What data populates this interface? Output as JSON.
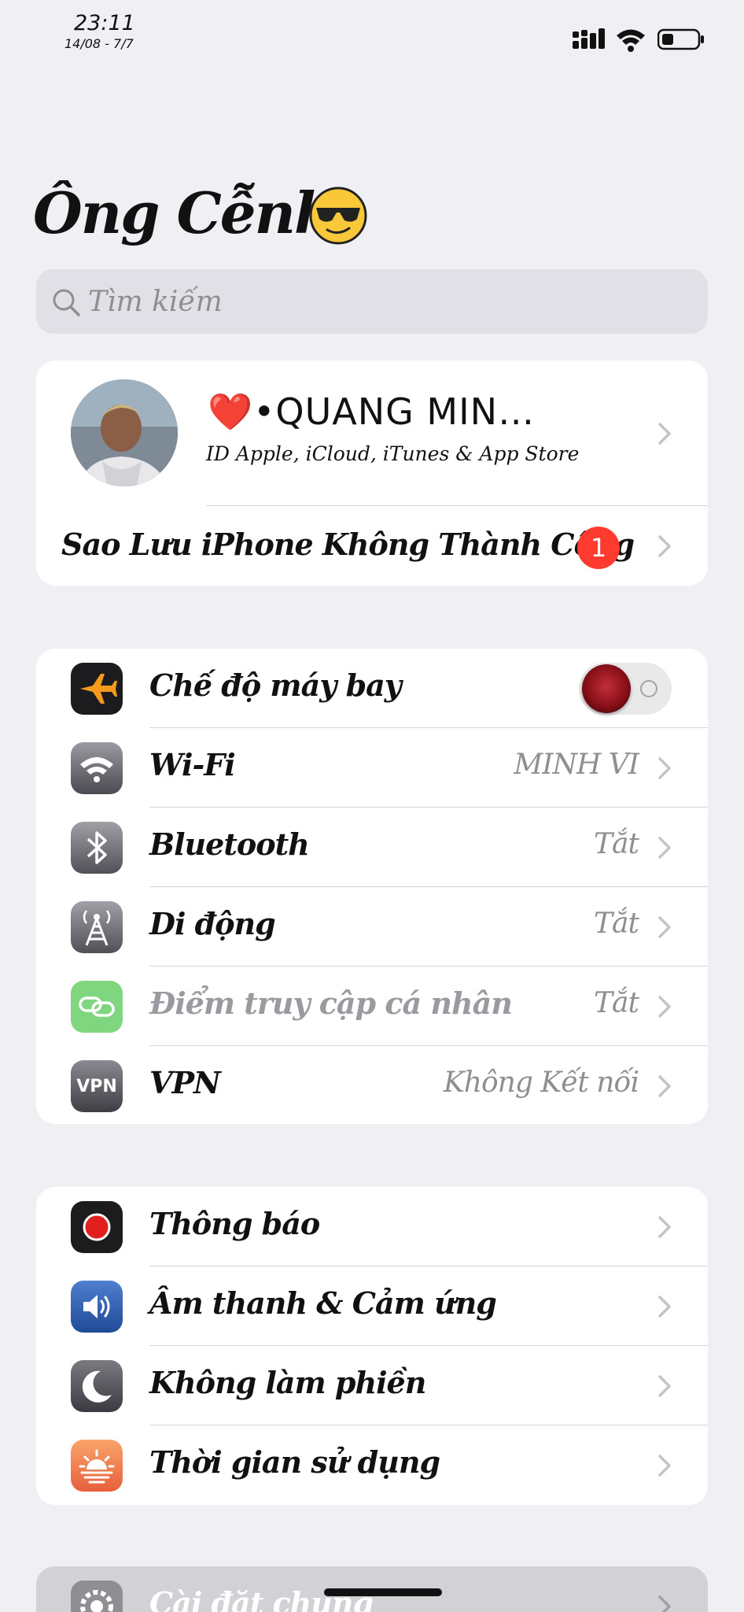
{
  "status_bar": {
    "time": "23:11",
    "date": "14/08 - 7/7"
  },
  "page_title": "Ông Cễnh",
  "search": {
    "placeholder": "Tìm kiếm"
  },
  "profile": {
    "name": "❤️•QUANG MIN…",
    "subtitle": "ID Apple, iCloud, iTunes & App Store",
    "backup_label": "Sao Lưu iPhone Không Thành Công",
    "backup_badge": "1"
  },
  "connectivity": [
    {
      "name": "airplane",
      "label": "Chế độ máy bay",
      "value": "",
      "toggle": true,
      "toggle_on": false
    },
    {
      "name": "wifi",
      "label": "Wi-Fi",
      "value": "MINH VI"
    },
    {
      "name": "bluetooth",
      "label": "Bluetooth",
      "value": "Tắt"
    },
    {
      "name": "cellular",
      "label": "Di động",
      "value": "Tắt"
    },
    {
      "name": "hotspot",
      "label": "Điểm truy cập cá nhân",
      "value": "Tắt",
      "dimmed": true
    },
    {
      "name": "vpn",
      "label": "VPN",
      "value": "Không Kết nối",
      "icon_text": "VPN"
    }
  ],
  "alerts": [
    {
      "name": "notifications",
      "label": "Thông báo"
    },
    {
      "name": "sounds",
      "label": "Âm thanh & Cảm ứng"
    },
    {
      "name": "do-not-disturb",
      "label": "Không làm phiền"
    },
    {
      "name": "screen-time",
      "label": "Thời gian sử dụng"
    }
  ],
  "general": {
    "label": "Cài đặt chung"
  },
  "colors": {
    "badge": "#ff3b30",
    "background": "#efeff4",
    "row_bg": "#ffffff",
    "chevron": "#c4c4c7"
  }
}
